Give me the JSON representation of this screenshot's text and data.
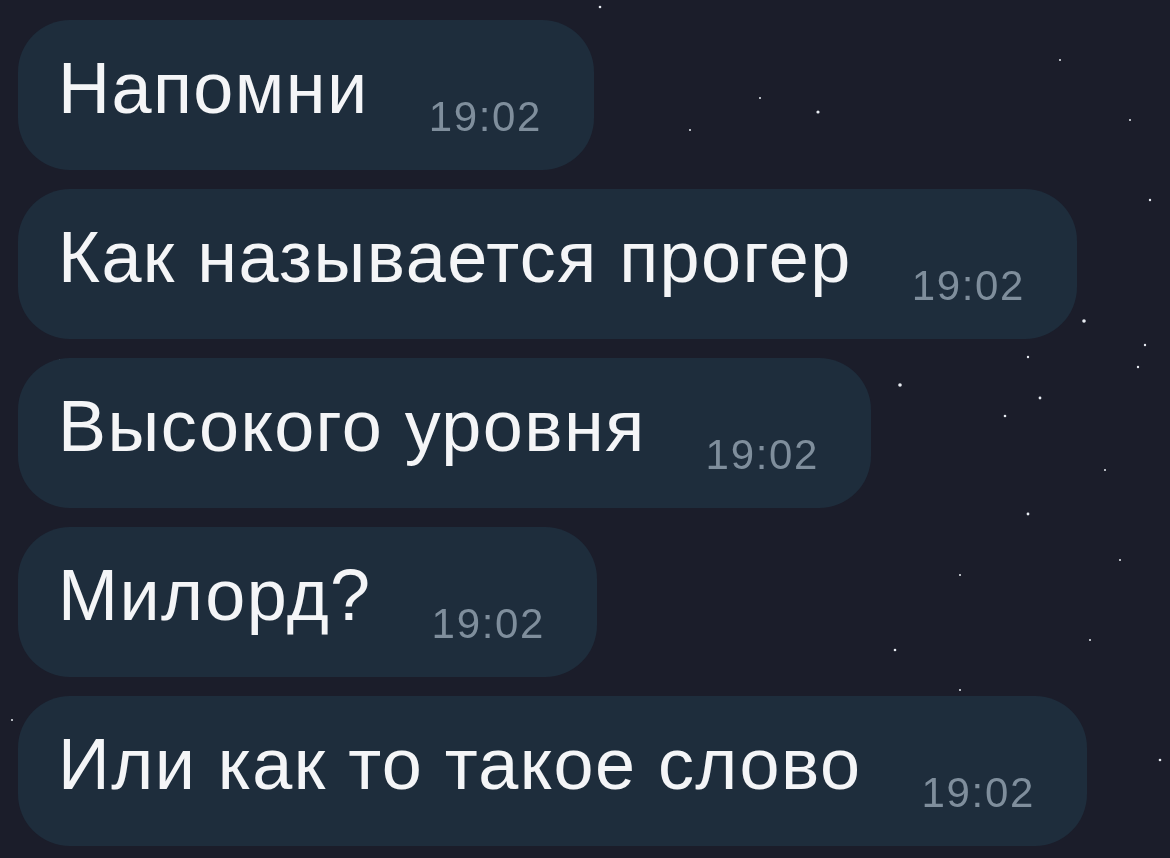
{
  "messages": [
    {
      "text": "Напомни",
      "time": "19:02"
    },
    {
      "text": "Как называется прогер",
      "time": "19:02"
    },
    {
      "text": "Высокого уровня",
      "time": "19:02"
    },
    {
      "text": "Милорд?",
      "time": "19:02"
    },
    {
      "text": "Или как то такое слово",
      "time": "19:02"
    }
  ]
}
